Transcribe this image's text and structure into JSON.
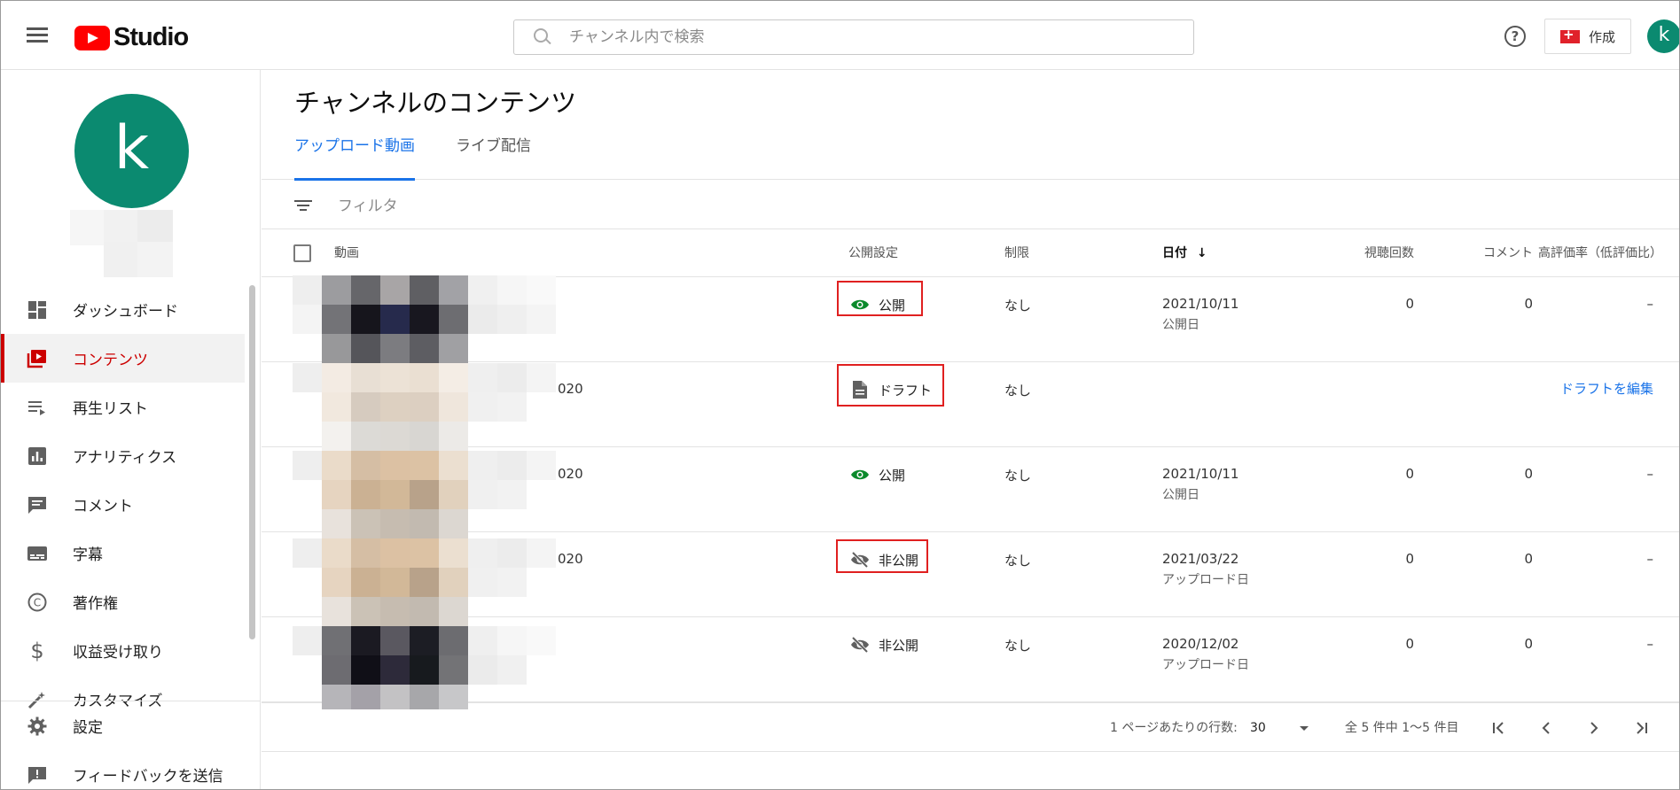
{
  "header": {
    "logo_text": "Studio",
    "search_placeholder": "チャンネル内で検索",
    "help_label": "?",
    "create_label": "作成",
    "avatar_letter": "k"
  },
  "sidebar": {
    "avatar_letter": "k",
    "items": [
      {
        "label": "ダッシュボード",
        "icon": "dashboard-icon",
        "active": false
      },
      {
        "label": "コンテンツ",
        "icon": "content-icon",
        "active": true
      },
      {
        "label": "再生リスト",
        "icon": "playlist-icon",
        "active": false
      },
      {
        "label": "アナリティクス",
        "icon": "analytics-icon",
        "active": false
      },
      {
        "label": "コメント",
        "icon": "comment-icon",
        "active": false
      },
      {
        "label": "字幕",
        "icon": "subtitles-icon",
        "active": false
      },
      {
        "label": "著作権",
        "icon": "copyright-icon",
        "active": false
      },
      {
        "label": "収益受け取り",
        "icon": "dollar-icon",
        "active": false
      },
      {
        "label": "カスタマイズ",
        "icon": "magic-wand-icon",
        "active": false
      }
    ],
    "bottom_items": [
      {
        "label": "設定",
        "icon": "gear-icon"
      },
      {
        "label": "フィードバックを送信",
        "icon": "feedback-icon"
      }
    ]
  },
  "main": {
    "title": "チャンネルのコンテンツ",
    "tabs": [
      {
        "label": "アップロード動画",
        "active": true
      },
      {
        "label": "ライブ配信",
        "active": false
      }
    ],
    "filter_label": "フィルタ",
    "columns": {
      "video": "動画",
      "visibility": "公開設定",
      "restrictions": "制限",
      "date": "日付",
      "date_sort_icon": "↓",
      "views": "視聴回数",
      "comments": "コメント",
      "likes": "高評価率（低評価比）"
    },
    "rows": [
      {
        "title_fragment": "",
        "visibility": "公開",
        "visibility_icon": "eye-icon",
        "restriction": "なし",
        "date": "2021/10/11",
        "date_sub": "公開日",
        "views": "0",
        "comments": "0",
        "likes": "–",
        "action": ""
      },
      {
        "title_fragment": "020",
        "visibility": "ドラフト",
        "visibility_icon": "draft-document-icon",
        "restriction": "なし",
        "date": "",
        "date_sub": "",
        "views": "",
        "comments": "",
        "likes": "",
        "action": "ドラフトを編集"
      },
      {
        "title_fragment": "020",
        "visibility": "公開",
        "visibility_icon": "eye-icon",
        "restriction": "なし",
        "date": "2021/10/11",
        "date_sub": "公開日",
        "views": "0",
        "comments": "0",
        "likes": "–",
        "action": ""
      },
      {
        "title_fragment": "020",
        "visibility": "非公開",
        "visibility_icon": "eye-off-icon",
        "restriction": "なし",
        "date": "2021/03/22",
        "date_sub": "アップロード日",
        "views": "0",
        "comments": "0",
        "likes": "–",
        "action": ""
      },
      {
        "title_fragment": "",
        "visibility": "非公開",
        "visibility_icon": "eye-off-icon",
        "restriction": "なし",
        "date": "2020/12/02",
        "date_sub": "アップロード日",
        "views": "0",
        "comments": "0",
        "likes": "–",
        "action": ""
      }
    ],
    "pagination": {
      "rows_per_page_label": "1 ページあたりの行数:",
      "rows_per_page_value": "30",
      "range_text": "全 5 件中 1～5 件目"
    }
  },
  "colors": {
    "brand_red": "#ff0000",
    "active_red": "#cc0000",
    "accent_blue": "#1a73e8",
    "public_green": "#0b8a2b",
    "avatar_teal": "#0b8a70",
    "highlight_box": "#e02020"
  }
}
